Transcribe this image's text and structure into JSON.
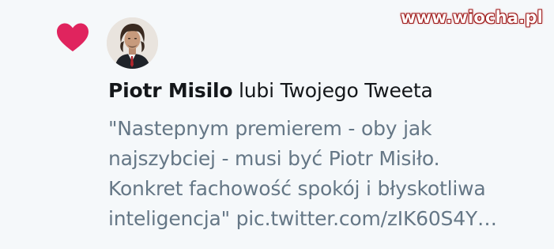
{
  "watermark": "www.wiocha.pl",
  "notification": {
    "icon": "heart-icon",
    "icon_color": "#e0245e",
    "user_name": "Piotr Misilo",
    "action_text": " lubi Twojego Tweeta",
    "tweet_lines": [
      "\"Nastepnym premierem - oby jak",
      "najszybciej - musi być Piotr Misiło.",
      "Konkret fachowość spokój i błyskotliwa",
      "inteligencja\" pic.twitter.com/zIK60S4Y…"
    ]
  }
}
